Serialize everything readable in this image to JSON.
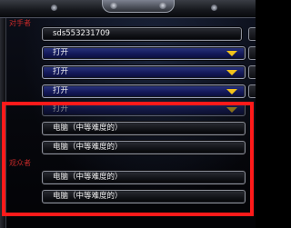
{
  "teams": [
    {
      "label": "对手者"
    },
    {
      "label": "观众者"
    }
  ],
  "slots": [
    {
      "kind": "name",
      "value": "sds553231709"
    },
    {
      "kind": "dropdown",
      "value": "打开"
    },
    {
      "kind": "dropdown",
      "value": "打开"
    },
    {
      "kind": "dropdown",
      "value": "打开"
    },
    {
      "kind": "dropdown",
      "value": "打开"
    },
    {
      "kind": "computer",
      "value": "电脑（中等难度的）"
    },
    {
      "kind": "computer",
      "value": "电脑（中等难度的）"
    },
    {
      "kind": "computer",
      "value": "电脑（中等难度的）"
    },
    {
      "kind": "computer",
      "value": "电脑（中等难度的）"
    }
  ],
  "colors": {
    "highlight": "#ff1a1a",
    "team_label": "#c02828",
    "dropdown_arrow": "#f2c21b"
  }
}
